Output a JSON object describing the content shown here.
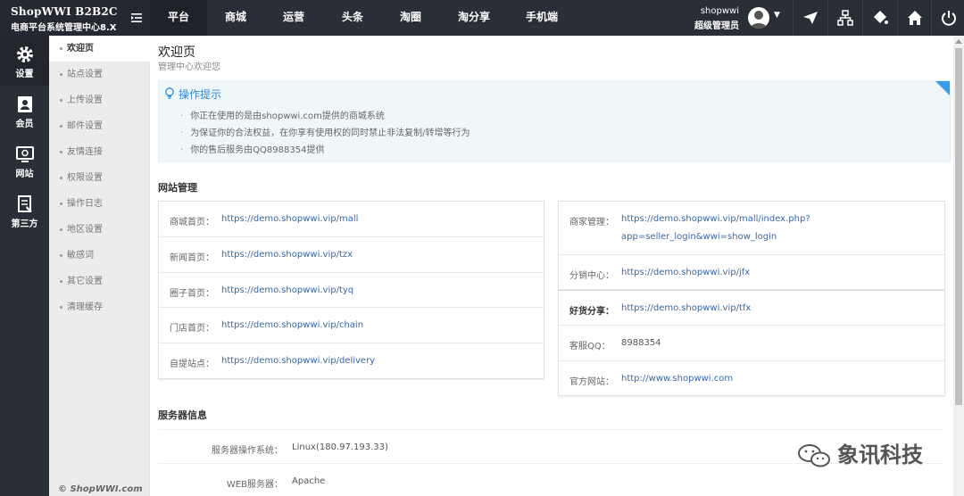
{
  "brand": {
    "title": "ShopWWI B2B2C",
    "subtitle": "电商平台系统管理中心8.X"
  },
  "topnav": [
    {
      "label": "平台",
      "active": true
    },
    {
      "label": "商城"
    },
    {
      "label": "运营"
    },
    {
      "label": "头条"
    },
    {
      "label": "淘圈"
    },
    {
      "label": "淘分享"
    },
    {
      "label": "手机端"
    }
  ],
  "user": {
    "name": "shopwwi",
    "role": "超级管理员"
  },
  "toolbar_icons": [
    "plane-icon",
    "sitemap-icon",
    "paint-bucket-icon",
    "home-icon",
    "power-icon"
  ],
  "rail": [
    {
      "label": "设置",
      "icon": "gear-icon",
      "active": true
    },
    {
      "label": "会员",
      "icon": "member-icon"
    },
    {
      "label": "网站",
      "icon": "website-icon"
    },
    {
      "label": "第三方",
      "icon": "third-party-icon"
    }
  ],
  "submenu": [
    {
      "label": "欢迎页",
      "active": true
    },
    {
      "label": "站点设置"
    },
    {
      "label": "上传设置"
    },
    {
      "label": "邮件设置"
    },
    {
      "label": "友情连接"
    },
    {
      "label": "权限设置"
    },
    {
      "label": "操作日志"
    },
    {
      "label": "地区设置"
    },
    {
      "label": "敏感词"
    },
    {
      "label": "其它设置"
    },
    {
      "label": "清理缓存"
    }
  ],
  "copyright": "© ShopWWI.com",
  "page": {
    "title": "欢迎页",
    "subtitle": "管理中心欢迎您"
  },
  "tips": {
    "title": "操作提示",
    "lines": [
      "你正在使用的是由shopwwi.com提供的商城系统",
      "为保证你的合法权益，在你享有使用权的同时禁止非法复制/转增等行为",
      "你的售后服务由QQ8988354提供"
    ]
  },
  "site_section_title": "网站管理",
  "left_links": [
    {
      "key": "商城首页：",
      "value": "https://demo.shopwwi.vip/mall"
    },
    {
      "key": "新闻首页：",
      "value": "https://demo.shopwwi.vip/tzx"
    },
    {
      "key": "圈子首页：",
      "value": "https://demo.shopwwi.vip/tyq"
    },
    {
      "key": "门店首页：",
      "value": "https://demo.shopwwi.vip/chain"
    },
    {
      "key": "自提站点：",
      "value": "https://demo.shopwwi.vip/delivery"
    }
  ],
  "right_links": [
    {
      "key": "商家管理：",
      "value": "https://demo.shopwwi.vip/mall/index.php?",
      "value2": "app=seller_login&wwi=show_login"
    },
    {
      "key": "分销中心：",
      "value": "https://demo.shopwwi.vip/jfx"
    },
    {
      "key": "好货分享：",
      "value": "https://demo.shopwwi.vip/tfx",
      "bold": true
    },
    {
      "key": "客服QQ：",
      "value": "8988354",
      "plain": true
    },
    {
      "key": "官方网站：",
      "value": "http://www.shopwwi.com"
    }
  ],
  "server_section_title": "服务器信息",
  "server": [
    {
      "key": "服务器操作系统：",
      "value": "Linux(180.97.193.33)"
    },
    {
      "key": "WEB服务器：",
      "value": "Apache"
    }
  ],
  "watermark": "象讯科技",
  "colors": {
    "topbar": "#2a2e36",
    "link": "#3a67a8",
    "tip_title": "#2e8ad8",
    "tip_corner": "#3a9be8"
  }
}
